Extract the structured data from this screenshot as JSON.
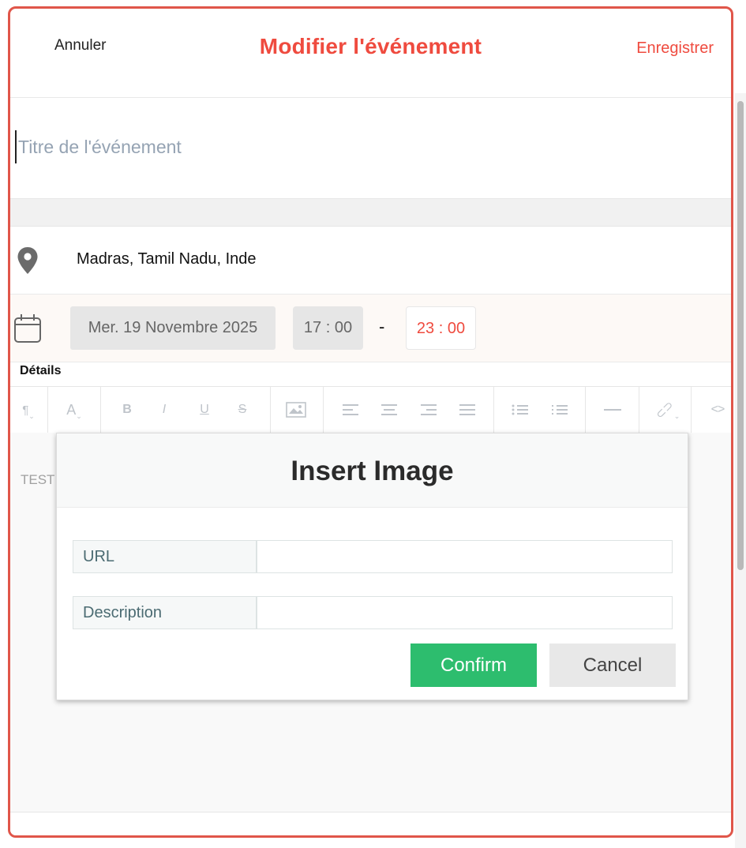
{
  "header": {
    "cancel_label": "Annuler",
    "title": "Modifier l'événement",
    "save_label": "Enregistrer"
  },
  "event": {
    "title_placeholder": "Titre de l'événement",
    "title_value": "",
    "location": "Madras, Tamil Nadu, Inde",
    "date": "Mer. 19 Novembre 2025",
    "start_time": "17 : 00",
    "time_separator": "-",
    "end_time": "23 : 00"
  },
  "details": {
    "label": "Détails",
    "toolbar_icons": [
      "paragraph-icon",
      "font-color-icon",
      "bold-icon",
      "italic-icon",
      "underline-icon",
      "strikethrough-icon",
      "image-icon",
      "align-left-icon",
      "align-center-icon",
      "align-right-icon",
      "align-justify-icon",
      "bullet-list-icon",
      "numbered-list-icon",
      "horizontal-rule-icon",
      "link-icon",
      "code-icon"
    ],
    "editor_text": "TEST"
  },
  "modal": {
    "title": "Insert Image",
    "url_label": "URL",
    "url_value": "",
    "description_label": "Description",
    "description_value": "",
    "confirm_label": "Confirm",
    "cancel_label": "Cancel"
  },
  "colors": {
    "accent": "#ef4b3f",
    "frame_border": "#e0564a",
    "confirm": "#2dbd6e",
    "placeholder": "#95a3b3"
  }
}
